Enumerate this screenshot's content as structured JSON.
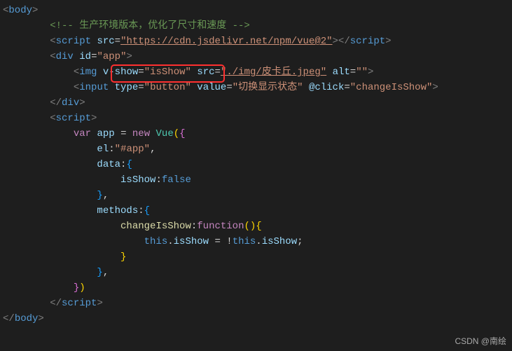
{
  "code": {
    "l1": {
      "tag": "body"
    },
    "l2": {
      "comment": "<!-- 生产环境版本，优化了尺寸和速度 -->"
    },
    "l3": {
      "tag": "script",
      "attr": "src",
      "val": "\"https://cdn.jsdelivr.net/npm/vue@2\""
    },
    "l4": {
      "tag": "div",
      "attr": "id",
      "val": "\"app\""
    },
    "l5": {
      "tag": "img",
      "a1": "v-show",
      "v1": "\"isShow\"",
      "a2": "src",
      "v2": "\"./img/皮卡丘.jpeg\"",
      "a3": "alt",
      "v3": "\"\""
    },
    "l6": {
      "tag": "input",
      "a1": "type",
      "v1": "\"button\"",
      "a2": "value",
      "v2": "\"切换显示状态\"",
      "a3": "@click",
      "v3": "\"changeIsShow\""
    },
    "l7": {
      "close": "div"
    },
    "l8": {
      "tag": "script"
    },
    "l9": {
      "kw": "var",
      "name": "app",
      "eq": " = ",
      "new": "new",
      "cls": "Vue",
      "open": "({"
    },
    "l10": {
      "prop": "el",
      "val": "\"#app\""
    },
    "l11": {
      "prop": "data",
      "open": ":{"
    },
    "l12": {
      "prop": "isShow",
      "val": "false"
    },
    "l13": {
      "close": "},"
    },
    "l14": {
      "prop": "methods",
      "open": ":{"
    },
    "l15": {
      "fn": "changeIsShow",
      "kw": "function",
      "open": "(){"
    },
    "l16": {
      "this1": "this",
      "p1": "isShow",
      "eq": " = !",
      "this2": "this",
      "p2": "isShow",
      "semi": ";"
    },
    "l17": {
      "close": "}"
    },
    "l18": {
      "close": "},"
    },
    "l19": {
      "close": "})"
    },
    "l20": {
      "close": "script"
    },
    "l21": {
      "close": "body"
    }
  },
  "watermark": "CSDN @南绘"
}
